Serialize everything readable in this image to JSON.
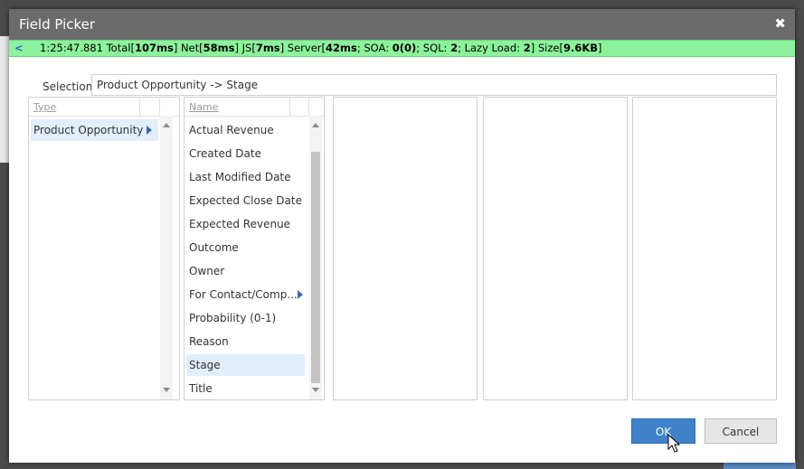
{
  "dialog": {
    "title": "Field Picker",
    "close_label": "✖"
  },
  "perf": {
    "toggle": "<",
    "time": "1:25:47.881",
    "total_label": "Total[",
    "total": "107ms",
    "net_label": "] Net[",
    "net": "58ms",
    "js_label": "] JS[",
    "js": "7ms",
    "server_label": "] Server[",
    "server": "42ms",
    "soa_label": "; SOA: ",
    "soa": "0(0)",
    "sql_label": "; SQL: ",
    "sql": "2",
    "lazy_label": "; Lazy Load: ",
    "lazy": "2",
    "size_label": "] Size[",
    "size": "9.6KB",
    "end": "]"
  },
  "selection": {
    "label": "Selection",
    "value": "Product Opportunity -> Stage"
  },
  "type_column": {
    "header": "Type",
    "items": [
      {
        "label": "Product Opportunity",
        "selected": true,
        "has_children": true
      }
    ]
  },
  "name_column": {
    "header": "Name",
    "items": [
      {
        "label": "Actual Revenue"
      },
      {
        "label": "Created Date"
      },
      {
        "label": "Last Modified Date"
      },
      {
        "label": "Expected Close Date"
      },
      {
        "label": "Expected Revenue"
      },
      {
        "label": "Outcome"
      },
      {
        "label": "Owner"
      },
      {
        "label": "For Contact/Comp...",
        "has_children": true
      },
      {
        "label": "Probability (0-1)"
      },
      {
        "label": "Reason"
      },
      {
        "label": "Stage",
        "selected": true
      },
      {
        "label": "Title"
      }
    ]
  },
  "buttons": {
    "ok": "OK",
    "cancel": "Cancel"
  },
  "colors": {
    "title_bar": "#6b6b6b",
    "perf_bar": "#8cf29b",
    "ok_button": "#3f82c9",
    "selected_row": "#e2eefc"
  }
}
